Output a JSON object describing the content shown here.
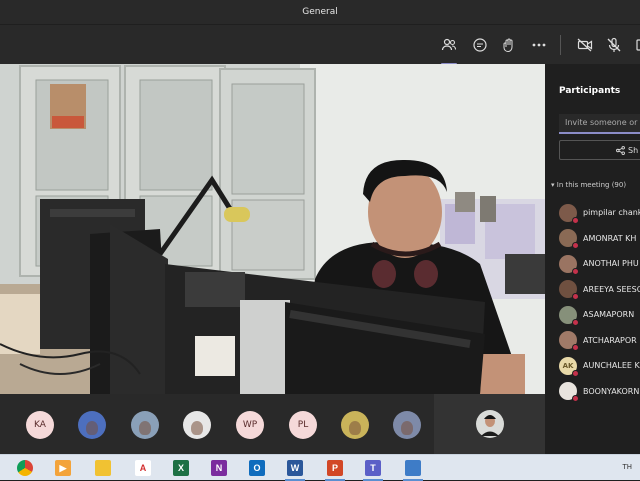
{
  "window": {
    "title": "General"
  },
  "toolbar": {
    "icons": [
      "participants-icon",
      "chat-icon",
      "reactions-icon",
      "more-icon",
      "camera-off-icon",
      "mic-off-icon"
    ],
    "accent": "#8b8cc7"
  },
  "participants_panel": {
    "title": "Participants",
    "invite_placeholder": "Invite someone or d",
    "share_label": "Sh",
    "in_meeting_label": "In this meeting (90)",
    "people": [
      {
        "name": "pimpilar chank",
        "initials": "",
        "kind": "photo"
      },
      {
        "name": "AMONRAT KH",
        "initials": "",
        "kind": "photo"
      },
      {
        "name": "ANOTHAI PHU",
        "initials": "",
        "kind": "photo"
      },
      {
        "name": "AREEYA SEESO",
        "initials": "",
        "kind": "photo"
      },
      {
        "name": "ASAMAPORN",
        "initials": "",
        "kind": "photo"
      },
      {
        "name": "ATCHARAPOR",
        "initials": "",
        "kind": "photo"
      },
      {
        "name": "AUNCHALEE K",
        "initials": "AK",
        "kind": "initials"
      },
      {
        "name": "BOONYAKORN",
        "initials": "",
        "kind": "photo"
      }
    ]
  },
  "video_strip": {
    "tiles": [
      {
        "initials": "KA",
        "kind": "initials"
      },
      {
        "initials": "",
        "kind": "photo"
      },
      {
        "initials": "",
        "kind": "photo"
      },
      {
        "initials": "",
        "kind": "photo"
      },
      {
        "initials": "WP",
        "kind": "initials"
      },
      {
        "initials": "PL",
        "kind": "initials"
      },
      {
        "initials": "",
        "kind": "photo"
      },
      {
        "initials": "",
        "kind": "photo"
      }
    ]
  },
  "taskbar": {
    "apps": [
      "chrome-icon",
      "media-player-icon",
      "file-explorer-icon",
      "acrobat-icon",
      "excel-icon",
      "onenote-icon",
      "outlook-icon",
      "word-icon",
      "powerpoint-icon",
      "teams-icon",
      "network-icon"
    ],
    "tray_text": "TH"
  }
}
